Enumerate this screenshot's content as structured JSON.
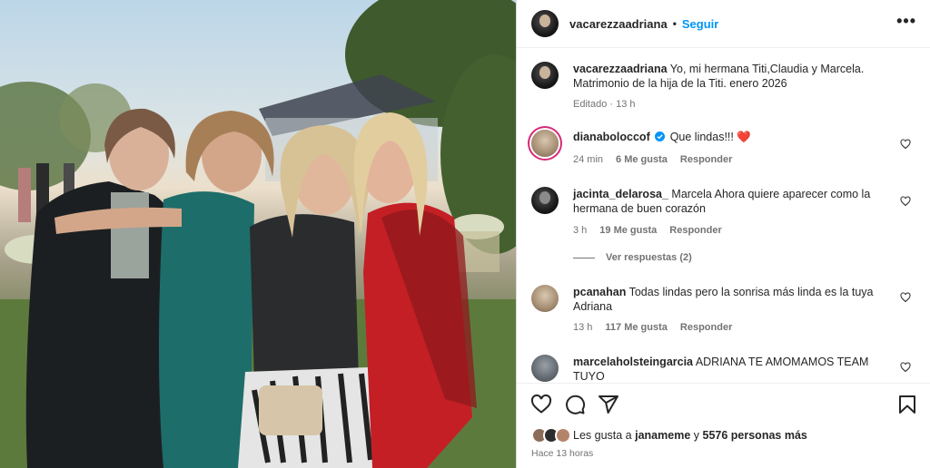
{
  "post": {
    "username": "vacarezzaadriana",
    "follow_label": "Seguir",
    "separator": "•",
    "more_glyph": "•••"
  },
  "caption": {
    "username": "vacarezzaadriana",
    "text": "Yo, mi hermana Titi,Claudia y Marcela. Matrimonio de la hija de la Titi. enero 2026",
    "edited": "Editado",
    "time": "13 h"
  },
  "comments": [
    {
      "username": "dianaboloccof",
      "verified": true,
      "text": "Que lindas!!! ❤️",
      "time": "24 min",
      "likes": "6 Me gusta",
      "reply": "Responder"
    },
    {
      "username": "jacinta_delarosa_",
      "verified": false,
      "text": "Marcela Ahora quiere aparecer como la hermana de buen corazón",
      "time": "3 h",
      "likes": "19 Me gusta",
      "reply": "Responder",
      "view_replies": "Ver respuestas (2)"
    },
    {
      "username": "pcanahan",
      "verified": false,
      "text": "Todas lindas pero la sonrisa más linda es la tuya Adriana",
      "time": "13 h",
      "likes": "117 Me gusta",
      "reply": "Responder"
    },
    {
      "username": "marcelaholsteingarcia",
      "verified": false,
      "text": "ADRIANA TE AMOMAMOS TEAM TUYO",
      "emojis": "❤️ 🙌 👏"
    }
  ],
  "likes": {
    "prefix": "Les gusta a",
    "user": "janameme",
    "connector": "y",
    "count": "5576 personas más"
  },
  "posted_ago": "Hace 13 horas",
  "icons": [
    "heart-icon",
    "comment-icon",
    "share-icon",
    "bookmark-icon",
    "more-icon",
    "verified-icon"
  ],
  "colors": {
    "follow": "#0095f6",
    "verified": "#0095f6",
    "text": "#262626",
    "muted": "#737373"
  }
}
